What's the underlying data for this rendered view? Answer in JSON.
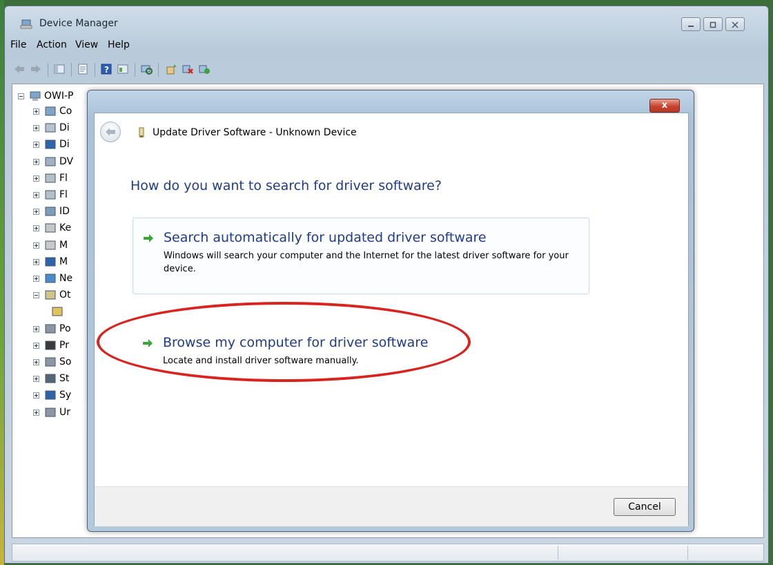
{
  "window": {
    "title": "Device Manager",
    "icon": "device-manager-icon"
  },
  "menubar": {
    "items": [
      "File",
      "Action",
      "View",
      "Help"
    ]
  },
  "toolbar": {
    "icons": [
      "back-arrow-icon",
      "forward-arrow-icon",
      "show-hide-tree-icon",
      "properties-icon",
      "help-icon",
      "view-icon",
      "scan-hardware-icon",
      "update-driver-icon",
      "uninstall-icon",
      "enable-device-icon"
    ]
  },
  "tree": {
    "root": "OWI-P",
    "items": [
      {
        "label": "Co",
        "icon": "computer-icon"
      },
      {
        "label": "Di",
        "icon": "disk-drive-icon"
      },
      {
        "label": "Di",
        "icon": "display-adapter-icon"
      },
      {
        "label": "DV",
        "icon": "dvd-drive-icon"
      },
      {
        "label": "Fl",
        "icon": "floppy-controller-icon"
      },
      {
        "label": "Fl",
        "icon": "floppy-drive-icon"
      },
      {
        "label": "ID",
        "icon": "ide-controller-icon"
      },
      {
        "label": "Ke",
        "icon": "keyboard-icon"
      },
      {
        "label": "M",
        "icon": "mouse-icon"
      },
      {
        "label": "M",
        "icon": "monitor-icon"
      },
      {
        "label": "Ne",
        "icon": "network-adapter-icon"
      },
      {
        "label": "Ot",
        "icon": "other-devices-icon"
      },
      {
        "label": "",
        "icon": "unknown-device-icon"
      },
      {
        "label": "Po",
        "icon": "ports-icon"
      },
      {
        "label": "Pr",
        "icon": "processor-icon"
      },
      {
        "label": "So",
        "icon": "sound-icon"
      },
      {
        "label": "St",
        "icon": "storage-controller-icon"
      },
      {
        "label": "Sy",
        "icon": "system-devices-icon"
      },
      {
        "label": "Ur",
        "icon": "usb-controller-icon"
      }
    ]
  },
  "dialog": {
    "title": "Update Driver Software - Unknown Device",
    "question": "How do you want to search for driver software?",
    "option_auto": {
      "title": "Search automatically for updated driver software",
      "description": "Windows will search your computer and the Internet for the latest driver software for your device."
    },
    "option_browse": {
      "title": "Browse my computer for driver software",
      "description": "Locate and install driver software manually."
    },
    "cancel_label": "Cancel",
    "close_label": "x"
  },
  "colors": {
    "link_blue": "#1f3c88",
    "arrow_green": "#3aa33a",
    "highlight_red": "#d8231e",
    "close_red": "#c7442f"
  }
}
